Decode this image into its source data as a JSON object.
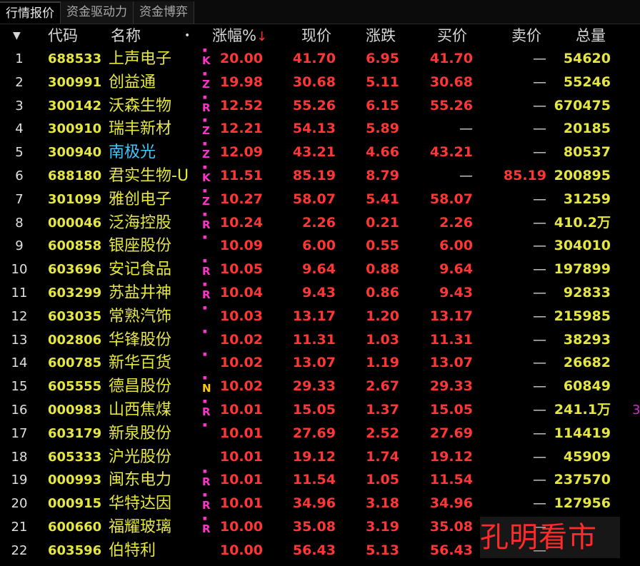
{
  "tabs": [
    {
      "label": "行情报价",
      "active": true
    },
    {
      "label": "资金驱动力",
      "active": false
    },
    {
      "label": "资金博弈",
      "active": false
    }
  ],
  "header": {
    "menu_icon": "triangle-down-icon",
    "code": "代码",
    "name": "名称",
    "dot": "•",
    "pct": "涨幅%",
    "sort_arrow": "↓",
    "price": "现价",
    "change": "涨跌",
    "bid": "买价",
    "ask": "卖价",
    "volume": "总量"
  },
  "rows": [
    {
      "idx": "1",
      "code": "688533",
      "name": "上声电子",
      "mark": "K",
      "pct": "20.00",
      "price": "41.70",
      "change": "6.95",
      "bid": "41.70",
      "ask": "—",
      "volume": "54620"
    },
    {
      "idx": "2",
      "code": "300991",
      "name": "创益通",
      "mark": "Z",
      "pct": "19.98",
      "price": "30.68",
      "change": "5.11",
      "bid": "30.68",
      "ask": "—",
      "volume": "55246"
    },
    {
      "idx": "3",
      "code": "300142",
      "name": "沃森生物",
      "mark": "R",
      "pct": "12.52",
      "price": "55.26",
      "change": "6.15",
      "bid": "55.26",
      "ask": "—",
      "volume": "670475"
    },
    {
      "idx": "4",
      "code": "300910",
      "name": "瑞丰新材",
      "mark": "Z",
      "pct": "12.21",
      "price": "54.13",
      "change": "5.89",
      "bid": "—",
      "ask": "—",
      "volume": "20185"
    },
    {
      "idx": "5",
      "code": "300940",
      "name": "南极光",
      "mark": "Z",
      "pct": "12.09",
      "price": "43.21",
      "change": "4.66",
      "bid": "43.21",
      "ask": "—",
      "volume": "80537",
      "name_color": "#3fc8ff"
    },
    {
      "idx": "6",
      "code": "688180",
      "name": "君实生物-U",
      "mark": "K",
      "pct": "11.51",
      "price": "85.19",
      "change": "8.79",
      "bid": "—",
      "ask": "85.19",
      "volume": "200895"
    },
    {
      "idx": "7",
      "code": "301099",
      "name": "雅创电子",
      "mark": "Z",
      "pct": "10.27",
      "price": "58.07",
      "change": "5.41",
      "bid": "58.07",
      "ask": "—",
      "volume": "31259"
    },
    {
      "idx": "8",
      "code": "000046",
      "name": "泛海控股",
      "mark": "R",
      "pct": "10.24",
      "price": "2.26",
      "change": "0.21",
      "bid": "2.26",
      "ask": "—",
      "volume": "410.2万"
    },
    {
      "idx": "9",
      "code": "600858",
      "name": "银座股份",
      "mark": "",
      "pct": "10.09",
      "price": "6.00",
      "change": "0.55",
      "bid": "6.00",
      "ask": "—",
      "volume": "304010"
    },
    {
      "idx": "10",
      "code": "603696",
      "name": "安记食品",
      "mark": "R",
      "pct": "10.05",
      "price": "9.64",
      "change": "0.88",
      "bid": "9.64",
      "ask": "—",
      "volume": "197899"
    },
    {
      "idx": "11",
      "code": "603299",
      "name": "苏盐井神",
      "mark": "R",
      "pct": "10.04",
      "price": "9.43",
      "change": "0.86",
      "bid": "9.43",
      "ask": "—",
      "volume": "92833"
    },
    {
      "idx": "12",
      "code": "603035",
      "name": "常熟汽饰",
      "mark": "",
      "pct": "10.03",
      "price": "13.17",
      "change": "1.20",
      "bid": "13.17",
      "ask": "—",
      "volume": "215985"
    },
    {
      "idx": "13",
      "code": "002806",
      "name": "华锋股份",
      "mark": "",
      "pct": "10.02",
      "price": "11.31",
      "change": "1.03",
      "bid": "11.31",
      "ask": "—",
      "volume": "38293"
    },
    {
      "idx": "14",
      "code": "600785",
      "name": "新华百货",
      "mark": "",
      "pct": "10.02",
      "price": "13.07",
      "change": "1.19",
      "bid": "13.07",
      "ask": "—",
      "volume": "26682"
    },
    {
      "idx": "15",
      "code": "605555",
      "name": "德昌股份",
      "mark": "N",
      "pct": "10.02",
      "price": "29.33",
      "change": "2.67",
      "bid": "29.33",
      "ask": "—",
      "volume": "60849",
      "mark_color": "#ffcc00"
    },
    {
      "idx": "16",
      "code": "000983",
      "name": "山西焦煤",
      "mark": "R",
      "pct": "10.01",
      "price": "15.05",
      "change": "1.37",
      "bid": "15.05",
      "ask": "—",
      "volume": "241.1万",
      "extra": "3"
    },
    {
      "idx": "17",
      "code": "603179",
      "name": "新泉股份",
      "mark": "",
      "pct": "10.01",
      "price": "27.69",
      "change": "2.52",
      "bid": "27.69",
      "ask": "—",
      "volume": "114419"
    },
    {
      "idx": "18",
      "code": "605333",
      "name": "沪光股份",
      "mark": "",
      "pct": "10.01",
      "price": "19.12",
      "change": "1.74",
      "bid": "19.12",
      "ask": "—",
      "volume": "45909",
      "no_dot": true
    },
    {
      "idx": "19",
      "code": "000993",
      "name": "闽东电力",
      "mark": "R",
      "pct": "10.01",
      "price": "11.54",
      "change": "1.05",
      "bid": "11.54",
      "ask": "—",
      "volume": "237570"
    },
    {
      "idx": "20",
      "code": "000915",
      "name": "华特达因",
      "mark": "R",
      "pct": "10.01",
      "price": "34.96",
      "change": "3.18",
      "bid": "34.96",
      "ask": "—",
      "volume": "127956"
    },
    {
      "idx": "21",
      "code": "600660",
      "name": "福耀玻璃",
      "mark": "R",
      "pct": "10.00",
      "price": "35.08",
      "change": "3.19",
      "bid": "35.08",
      "ask": "—",
      "volume": "—"
    },
    {
      "idx": "22",
      "code": "603596",
      "name": "伯特利",
      "mark": "",
      "pct": "10.00",
      "price": "56.43",
      "change": "5.13",
      "bid": "56.43",
      "ask": "—",
      "volume": "—",
      "no_dot": true
    }
  ],
  "watermark": "孔明看市",
  "colors": {
    "up": "#ff3636",
    "code": "#e6e640",
    "mark": "#ff33cc",
    "highlight_name": "#3fc8ff"
  }
}
